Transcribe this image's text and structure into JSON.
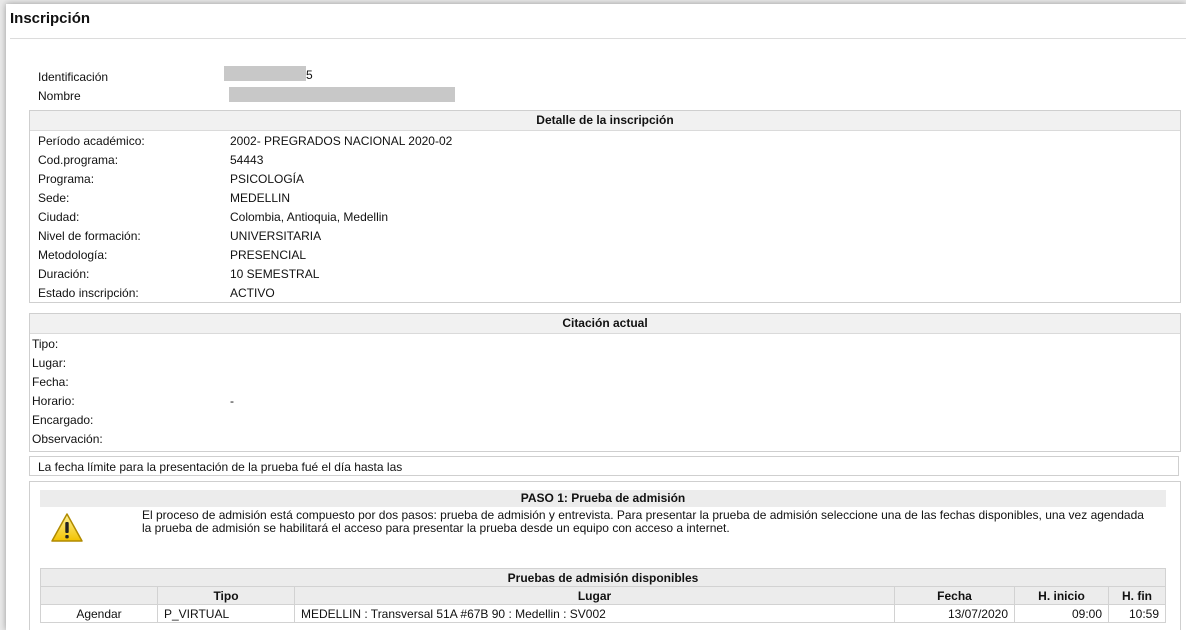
{
  "page": {
    "title": "Inscripción"
  },
  "identity": {
    "id_label": "Identificación",
    "id_value_tail": "5",
    "name_label": "Nombre"
  },
  "detalle": {
    "heading": "Detalle de la inscripción",
    "rows": [
      {
        "label": "Período académico:",
        "value": "2002- PREGRADOS NACIONAL 2020-02"
      },
      {
        "label": "Cod.programa:",
        "value": "54443"
      },
      {
        "label": "Programa:",
        "value": "PSICOLOGÍA"
      },
      {
        "label": "Sede:",
        "value": "MEDELLIN"
      },
      {
        "label": "Ciudad:",
        "value": "Colombia, Antioquia, Medellin"
      },
      {
        "label": "Nivel de formación:",
        "value": "UNIVERSITARIA"
      },
      {
        "label": "Metodología:",
        "value": "PRESENCIAL"
      },
      {
        "label": "Duración:",
        "value": "10 SEMESTRAL"
      },
      {
        "label": "Estado inscripción:",
        "value": "ACTIVO"
      }
    ]
  },
  "citacion": {
    "heading": "Citación actual",
    "rows": [
      {
        "label": "Tipo:",
        "value": ""
      },
      {
        "label": "Lugar:",
        "value": ""
      },
      {
        "label": "Fecha:",
        "value": ""
      },
      {
        "label": "Horario:",
        "value": "-"
      },
      {
        "label": "Encargado:",
        "value": ""
      },
      {
        "label": "Observación:",
        "value": ""
      }
    ]
  },
  "note": "La fecha límite para la presentación de la prueba fué el día hasta las",
  "paso1": {
    "heading": "PASO 1: Prueba de admisión",
    "text": "El proceso de admisión está compuesto por dos pasos: prueba de admisión y entrevista. Para presentar la prueba de admisión seleccione una de las fechas disponibles, una vez agendada la prueba de admisión se habilitará el acceso para presentar la prueba desde un equipo con acceso a internet."
  },
  "pruebas": {
    "caption": "Pruebas de admisión disponibles",
    "columns": [
      "",
      "Tipo",
      "Lugar",
      "Fecha",
      "H. inicio",
      "H. fin"
    ],
    "rows": [
      {
        "action": "Agendar",
        "tipo": "P_VIRTUAL",
        "lugar": "MEDELLIN : Transversal 51A #67B 90 : Medellin : SV002",
        "fecha": "13/07/2020",
        "h_inicio": "09:00",
        "h_fin": "10:59"
      }
    ]
  },
  "icons": {
    "warning": "warning-icon"
  },
  "colors": {
    "redaction": "#c8c8c8",
    "header_bg": "#f1f1f1",
    "warning_yellow": "#f7d51d"
  }
}
